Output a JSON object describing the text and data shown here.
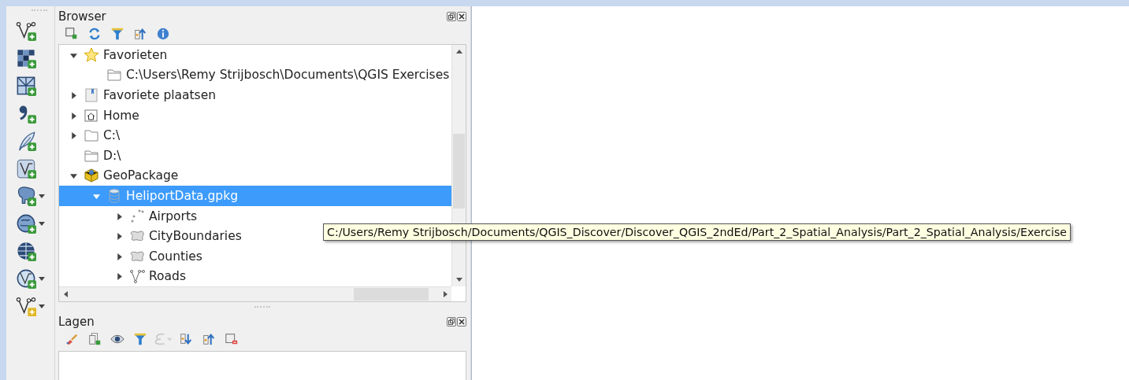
{
  "left_toolbar": [
    {
      "kind": "vector",
      "menu": false
    },
    {
      "kind": "raster",
      "menu": false
    },
    {
      "kind": "mesh",
      "menu": false
    },
    {
      "kind": "delimited",
      "menu": false
    },
    {
      "kind": "feather",
      "menu": false
    },
    {
      "kind": "virtual",
      "menu": false
    },
    {
      "kind": "postgres",
      "menu": true
    },
    {
      "kind": "globe",
      "menu": true
    },
    {
      "kind": "wms",
      "menu": false
    },
    {
      "kind": "wfs",
      "menu": true
    },
    {
      "kind": "newlayer",
      "menu": true
    }
  ],
  "browser": {
    "title": "Browser",
    "toolbar": [
      {
        "kind": "add"
      },
      {
        "kind": "refresh"
      },
      {
        "kind": "filter"
      },
      {
        "kind": "collapse"
      },
      {
        "kind": "info"
      }
    ],
    "tree": [
      {
        "label": "Favorieten",
        "kind": "star",
        "expanded": true,
        "selected": false,
        "children": [
          {
            "label": "C:\\Users\\Remy Strijbosch\\Documents\\QGIS Exercises",
            "kind": "folder-open",
            "selected": false
          }
        ]
      },
      {
        "label": "Favoriete plaatsen",
        "kind": "bookmark",
        "expanded": false,
        "selected": false
      },
      {
        "label": "Home",
        "kind": "home",
        "expanded": false,
        "selected": false
      },
      {
        "label": "C:\\",
        "kind": "folder",
        "expanded": false,
        "selected": false
      },
      {
        "label": "D:\\",
        "kind": "folder-open",
        "selected": false
      },
      {
        "label": "GeoPackage",
        "kind": "geopackage",
        "expanded": true,
        "selected": false,
        "children": [
          {
            "label": "HeliportData.gpkg",
            "kind": "database",
            "expanded": true,
            "selected": true,
            "children": [
              {
                "label": "Airports",
                "kind": "points",
                "expanded": false,
                "selected": false
              },
              {
                "label": "CityBoundaries",
                "kind": "polygon",
                "expanded": false,
                "selected": false
              },
              {
                "label": "Counties",
                "kind": "polygon",
                "expanded": false,
                "selected": false
              },
              {
                "label": "Roads",
                "kind": "line",
                "expanded": false,
                "selected": false
              }
            ]
          }
        ]
      }
    ]
  },
  "tooltip": "C:/Users/Remy Strijbosch/Documents/QGIS_Discover/Discover_QGIS_2ndEd/Part_2_Spatial_Analysis/Part_2_Spatial_Analysis/Exercise",
  "layers": {
    "title": "Lagen",
    "toolbar": [
      {
        "kind": "style",
        "disabled": false
      },
      {
        "kind": "add-group",
        "disabled": false
      },
      {
        "kind": "visibility",
        "disabled": false
      },
      {
        "kind": "filter",
        "disabled": false
      },
      {
        "kind": "expression",
        "disabled": true
      },
      {
        "kind": "expand",
        "disabled": false
      },
      {
        "kind": "collapse",
        "disabled": false
      },
      {
        "kind": "remove",
        "disabled": false
      }
    ]
  }
}
